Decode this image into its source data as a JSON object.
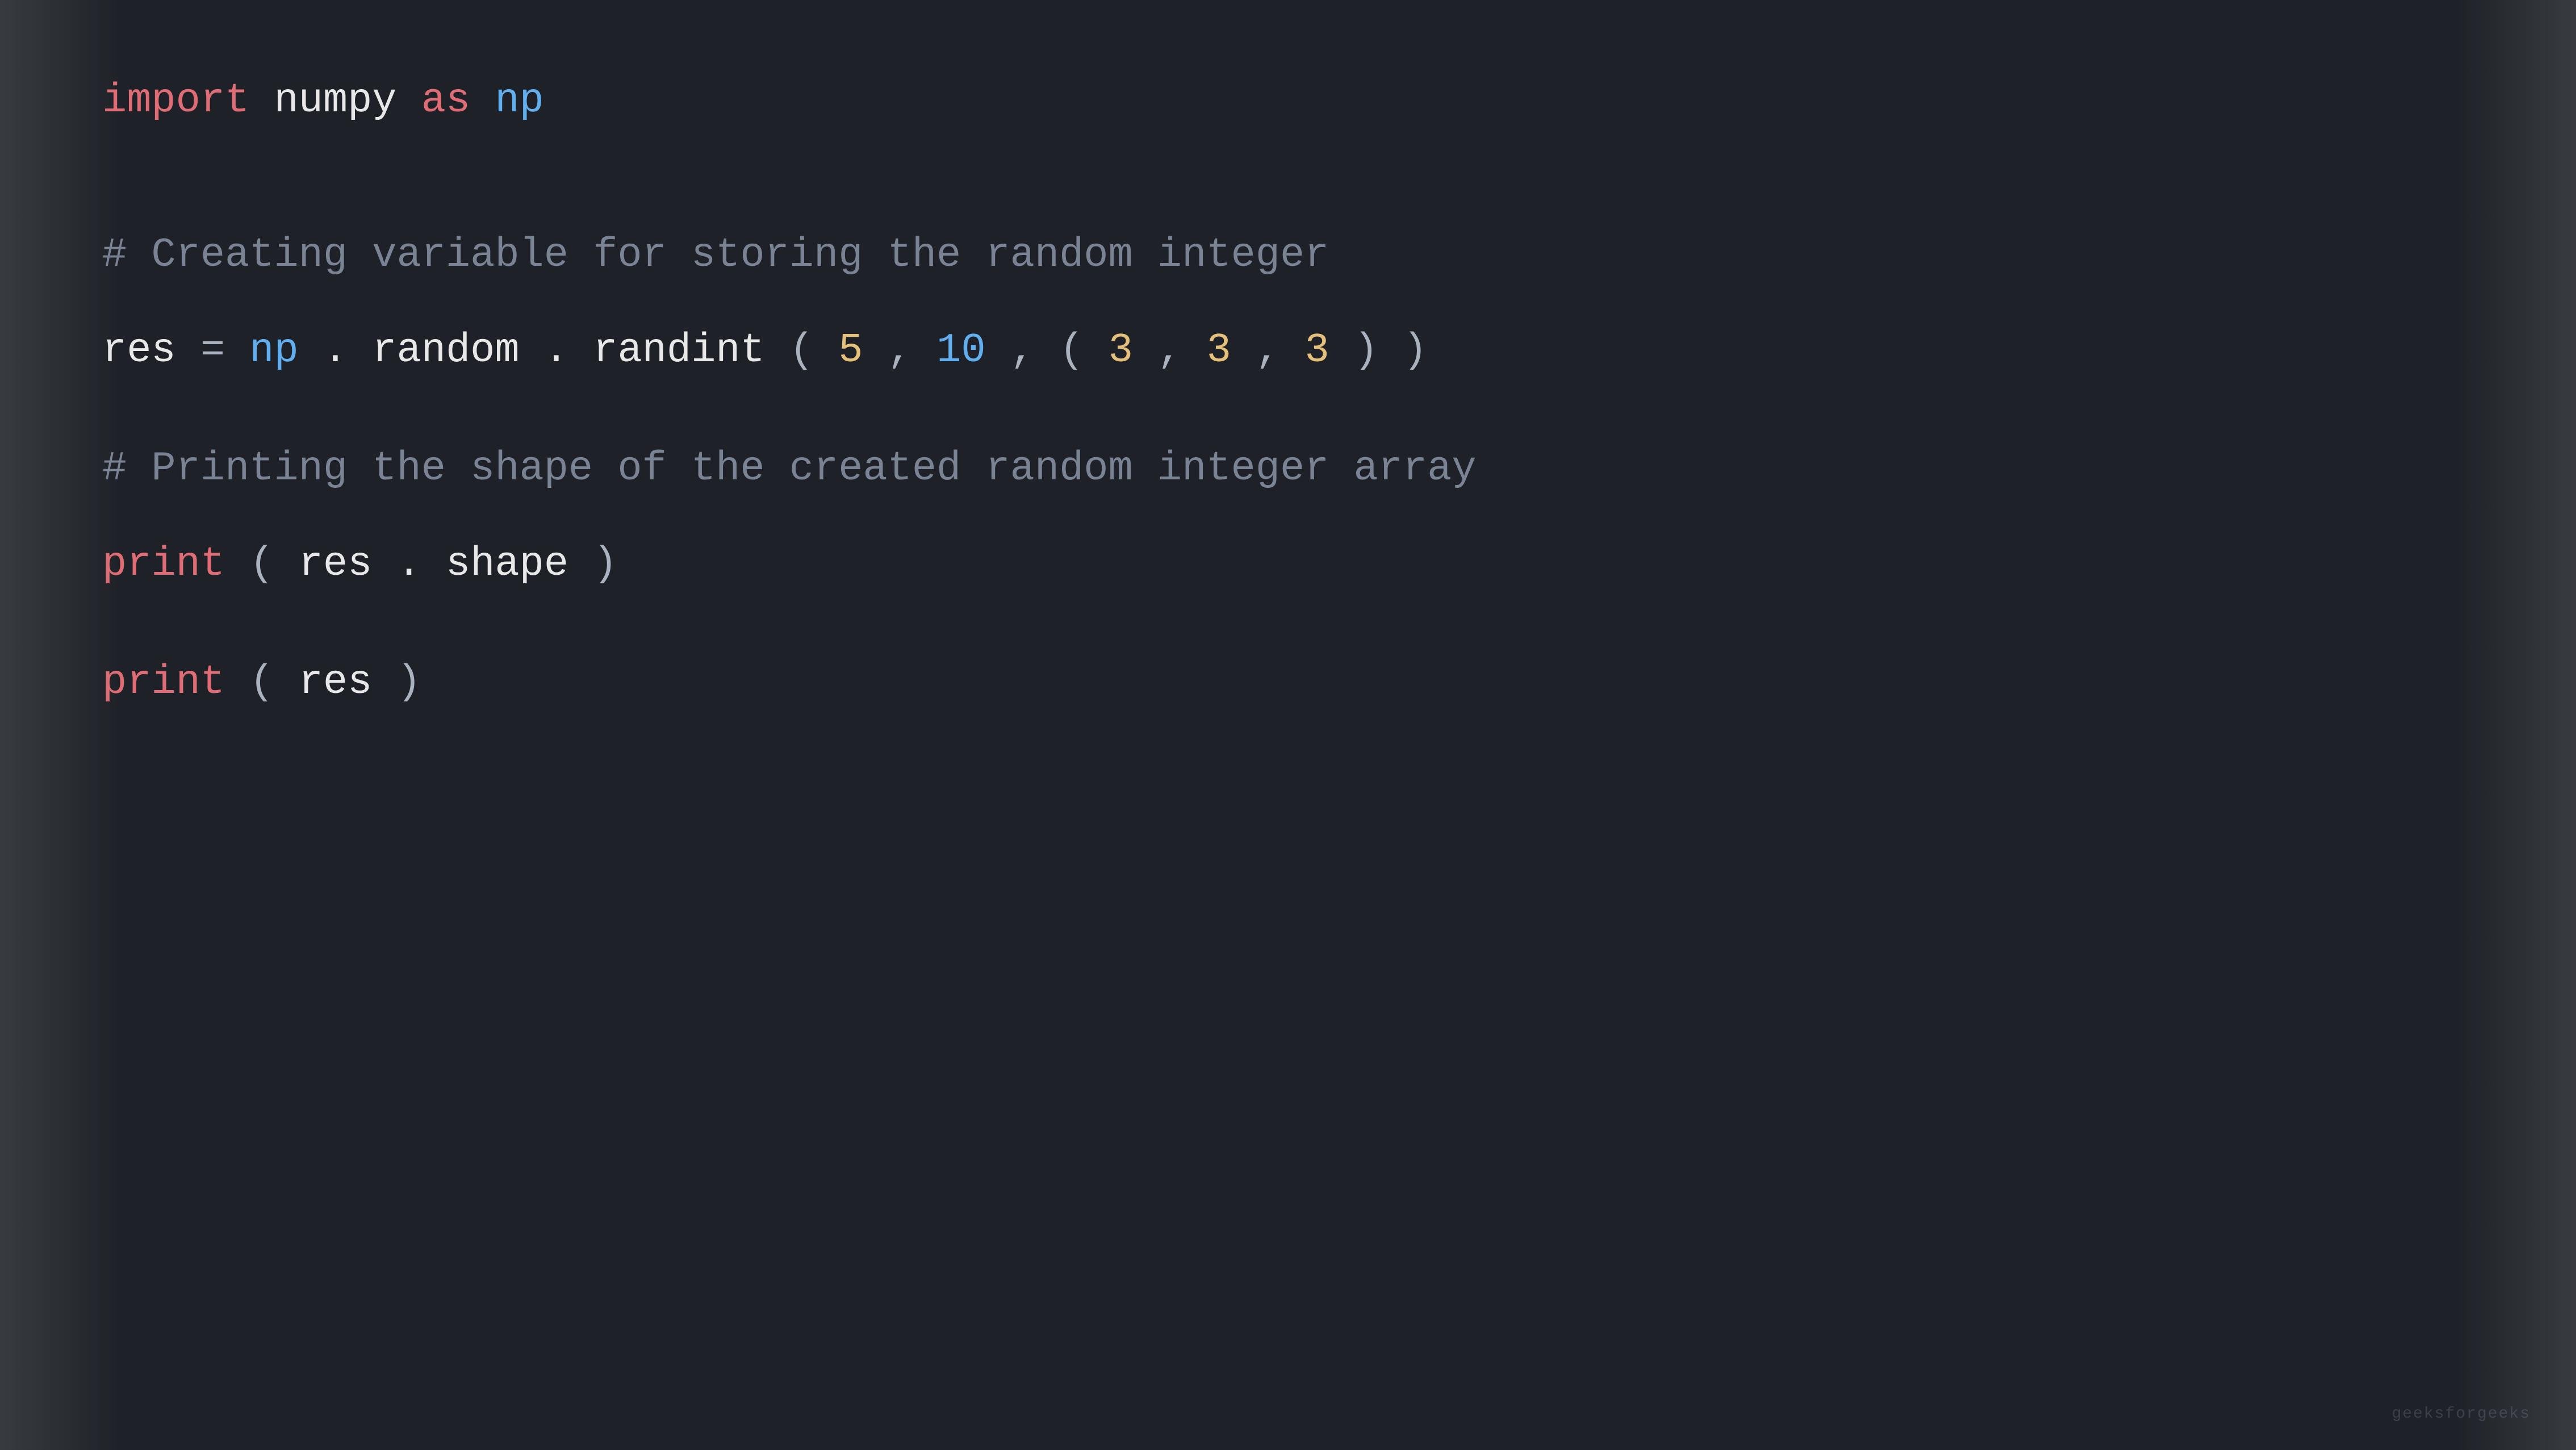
{
  "code": {
    "top_line": {
      "import_kw": "import",
      "module": "numpy",
      "as_kw": "as",
      "alias": "np"
    },
    "comment1": "# Creating variable for storing the random integer",
    "line1": {
      "var": "res",
      "op": " = ",
      "np": "np",
      "dot1": ".",
      "random": "random",
      "dot2": ".",
      "randint": "randint",
      "open_paren": "(",
      "n1": "5",
      "comma1": ", ",
      "n2": "10",
      "comma2": ", ",
      "open_tuple": "(",
      "n3": "3",
      "comma3": ", ",
      "n4": "3",
      "comma4": ", ",
      "n5": "3",
      "close_tuple": ")",
      "close_paren": ")"
    },
    "comment2": "# Printing the shape of the created random integer array",
    "line2": {
      "fn": "print",
      "open_paren": "(",
      "var": "res",
      "dot": ".",
      "attr": "shape",
      "close_paren": ")"
    },
    "line3": {
      "fn": "print",
      "open_paren": "(",
      "var": "res",
      "close_paren": ")"
    },
    "watermark": "geeksforgeeks"
  }
}
